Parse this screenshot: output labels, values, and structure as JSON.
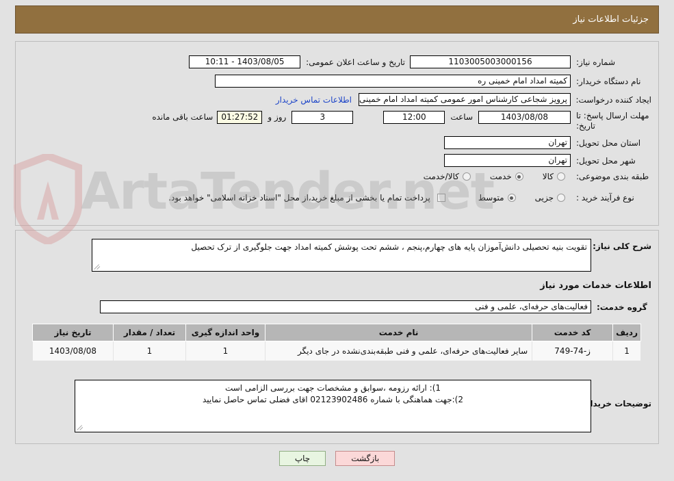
{
  "header": {
    "title": "جزئیات اطلاعات نیاز",
    "bg_color": "#91703f"
  },
  "watermark": {
    "text": "ArtaTender.net"
  },
  "main": {
    "need_number": {
      "label": "شماره نیاز:",
      "value": "1103005003000156"
    },
    "announce": {
      "label": "تاریخ و ساعت اعلان عمومی:",
      "value": "1403/08/05 - 10:11"
    },
    "buyer_org": {
      "label": "نام دستگاه خریدار:",
      "value": "کمیته امداد امام خمینی ره"
    },
    "requester": {
      "label": "ایجاد کننده درخواست:",
      "value": "پرویز شجاعی کارشناس امور عمومی کمیته امداد امام خمینی ره"
    },
    "contact_link": "اطلاعات تماس خریدار",
    "deadline": {
      "label": "مهلت ارسال پاسخ: تا تاریخ:",
      "date": "1403/08/08",
      "time_label": "ساعت",
      "time": "12:00",
      "days": "3",
      "days_suffix": "روز و",
      "countdown": "01:27:52",
      "countdown_suffix": "ساعت باقی مانده"
    },
    "province": {
      "label": "استان محل تحویل:",
      "value": "تهران"
    },
    "city": {
      "label": "شهر محل تحویل:",
      "value": "تهران"
    },
    "category": {
      "label": "طبقه بندی موضوعی:",
      "options": [
        "کالا",
        "خدمت",
        "کالا/خدمت"
      ],
      "selected": "خدمت"
    },
    "process": {
      "label": "نوع فرآیند خرید :",
      "options": [
        "جزیی",
        "متوسط"
      ],
      "selected": "متوسط",
      "note": "پرداخت تمام یا بخشی از مبلغ خرید،از محل \"اسناد خزانه اسلامی\" خواهد بود."
    }
  },
  "detail": {
    "summary": {
      "label": "شرح کلی نیاز:",
      "value": "تقویت بنیه تحصیلی دانش‌آموزان پایه های چهارم،پنجم ، ششم تحت پوشش کمیته امداد جهت جلوگیری از ترک تحصیل"
    },
    "services_heading": "اطلاعات خدمات مورد نیاز",
    "service_group": {
      "label": "گروه خدمت:",
      "value": "فعالیت‌های حرفه‌ای، علمی و فنی"
    },
    "table": {
      "columns": [
        "ردیف",
        "کد خدمت",
        "نام خدمت",
        "واحد اندازه گیری",
        "تعداد / مقدار",
        "تاریخ نیاز"
      ],
      "rows": [
        {
          "row_no": "1",
          "service_code": "ز-74-749",
          "service_name": "سایر فعالیت‌های حرفه‌ای، علمی و فنی طبقه‌بندی‌نشده در جای دیگر",
          "unit": "1",
          "quantity": "1",
          "need_date": "1403/08/08"
        }
      ]
    },
    "buyer_notes": {
      "label": "توضیحات خریدار:",
      "line1": "1): ارائه رزومه ،سوابق و مشخصات جهت بررسی الزامی است",
      "line2": "2):جهت هماهنگی با شماره 02123902486 اقای فضلی تماس حاصل نمایید"
    }
  },
  "footer": {
    "print_label": "چاپ",
    "back_label": "بازگشت"
  }
}
